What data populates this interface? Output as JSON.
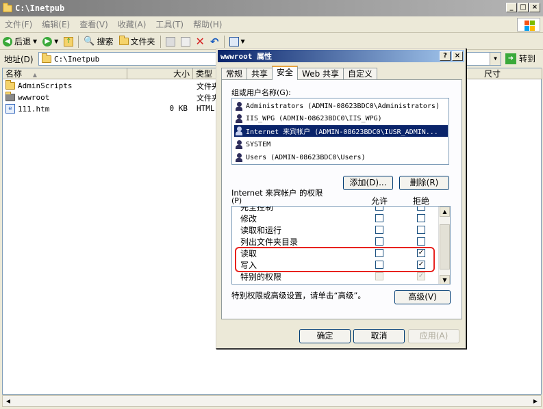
{
  "explorer": {
    "title": "C:\\Inetpub",
    "menu": [
      "文件(F)",
      "编辑(E)",
      "查看(V)",
      "收藏(A)",
      "工具(T)",
      "帮助(H)"
    ],
    "toolbar": {
      "back": "后退",
      "search": "搜索",
      "folders": "文件夹"
    },
    "address_label": "地址(D)",
    "address_value": "C:\\Inetpub",
    "go_label": "转到",
    "columns": [
      "名称",
      "大小",
      "类型",
      "尺寸"
    ],
    "files": [
      {
        "name": "AdminScripts",
        "size": "",
        "type": "文件夹"
      },
      {
        "name": "wwwroot",
        "size": "",
        "type": "文件夹"
      },
      {
        "name": "111.htm",
        "size": "0 KB",
        "type": "HTML"
      }
    ]
  },
  "dialog": {
    "title": "wwwroot 属性",
    "tabs": [
      "常规",
      "共享",
      "安全",
      "Web 共享",
      "自定义"
    ],
    "active_tab": "安全",
    "groups_label": "组或用户名称(G):",
    "users": [
      "Administrators (ADMIN-08623BDC0\\Administrators)",
      "IIS_WPG (ADMIN-08623BDC0\\IIS_WPG)",
      "Internet 来宾帐户 (ADMIN-08623BDC0\\IUSR_ADMIN...",
      "SYSTEM",
      "Users (ADMIN-08623BDC0\\Users)"
    ],
    "selected_user": 2,
    "add_button": "添加(D)...",
    "remove_button": "删除(R)",
    "perm_title": "Internet 来宾帐户 的权限",
    "perm_title2": "(P)",
    "allow_header": "允许",
    "deny_header": "拒绝",
    "permissions": [
      {
        "name": "完全控制",
        "allow": false,
        "deny": false
      },
      {
        "name": "修改",
        "allow": false,
        "deny": false
      },
      {
        "name": "读取和运行",
        "allow": false,
        "deny": false
      },
      {
        "name": "列出文件夹目录",
        "allow": false,
        "deny": false
      },
      {
        "name": "读取",
        "allow": false,
        "deny": true
      },
      {
        "name": "写入",
        "allow": false,
        "deny": true
      },
      {
        "name": "特别的权限",
        "allow": false,
        "deny": true
      }
    ],
    "advanced_text": "特别权限或高级设置，请单击“高级”。",
    "advanced_button": "高级(V)",
    "ok_button": "确定",
    "cancel_button": "取消",
    "apply_button": "应用(A)"
  },
  "colors": {
    "highlight": "#e8221e",
    "selection": "#0a246a",
    "dialog_title": "#0a246a"
  }
}
